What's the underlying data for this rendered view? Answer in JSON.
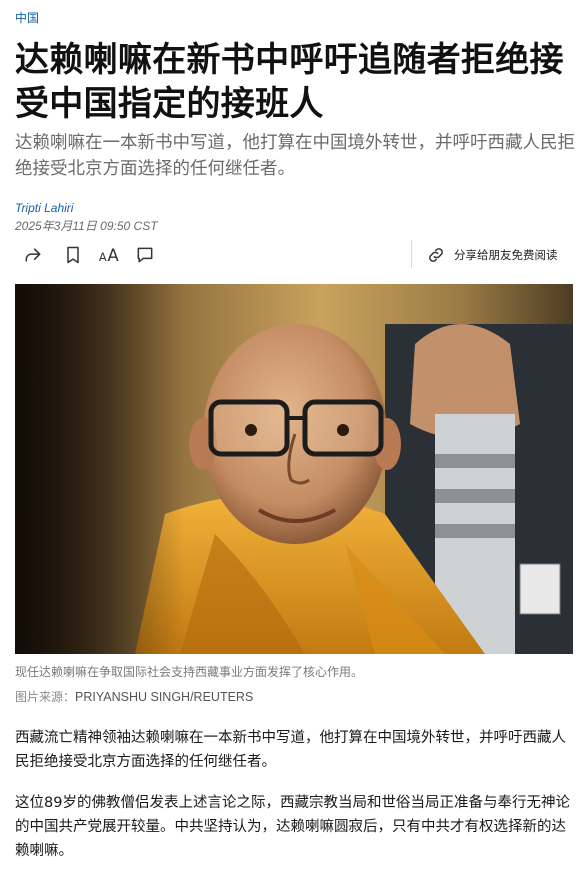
{
  "section": {
    "label": "中国"
  },
  "article": {
    "headline": "达赖喇嘛在新书中呼吁追随者拒绝接受中国指定的接班人",
    "standfirst": "达赖喇嘛在一本新书中写道，他打算在中国境外转世，并呼吁西藏人民拒绝接受北京方面选择的任何继任者。",
    "author": "Tripti Lahiri",
    "date": "2025年3月11日 09:50 CST"
  },
  "toolbar": {
    "share_icon": "share-arrow-icon",
    "bookmark_icon": "bookmark-icon",
    "fontsize_icon": "font-size-icon",
    "fontsize_label": "AA",
    "comment_icon": "comment-icon",
    "gift_icon": "link-icon",
    "gift_label": "分享给朋友免费阅读"
  },
  "image": {
    "caption": "现任达赖喇嘛在争取国际社会支持西藏事业方面发挥了核心作用。",
    "credit_prefix": "图片来源：",
    "credit_name": "PRIYANSHU SINGH/REUTERS"
  },
  "body": {
    "paragraphs": [
      "西藏流亡精神领袖达赖喇嘛在一本新书中写道，他打算在中国境外转世，并呼吁西藏人民拒绝接受北京方面选择的任何继任者。",
      "这位89岁的佛教僧侣发表上述言论之际，西藏宗教当局和世俗当局正准备与奉行无神论的中国共产党展开较量。中共坚持认为，达赖喇嘛圆寂后，只有中共才有权选择新的达赖喇嘛。"
    ]
  },
  "colors": {
    "link_blue": "#1560a8",
    "muted_gray": "#6b6b6b",
    "robe_orange": "#e0951a"
  }
}
